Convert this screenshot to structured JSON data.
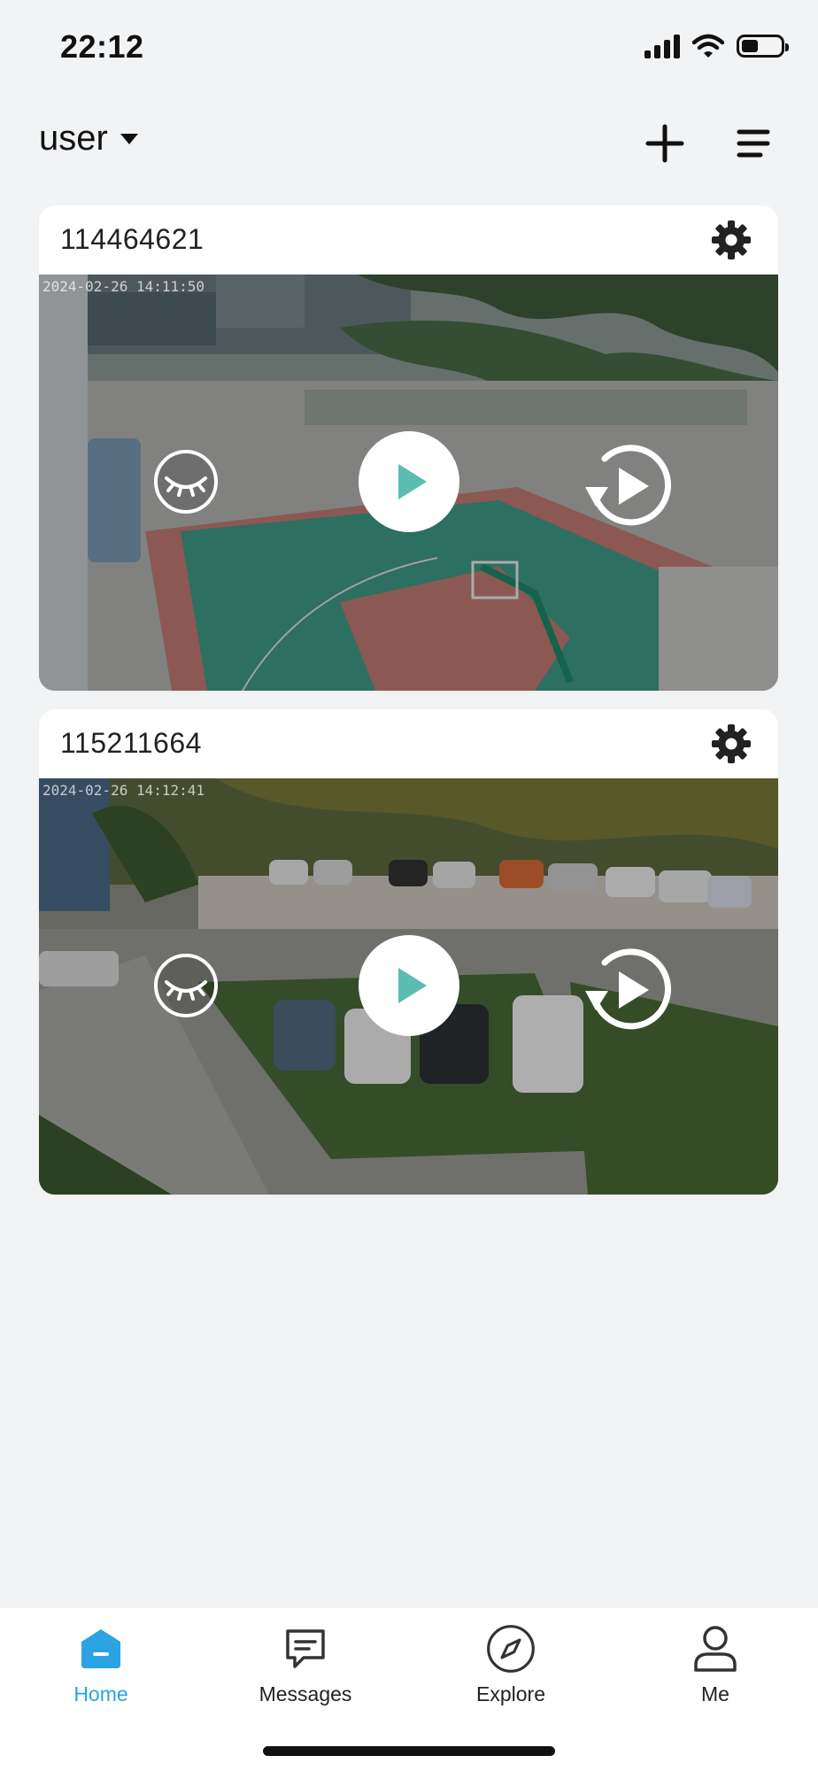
{
  "status_bar": {
    "time": "22:12"
  },
  "header": {
    "account": "user"
  },
  "devices": [
    {
      "id": "114464621",
      "timestamp": "2024-02-26 14:11:50"
    },
    {
      "id": "115211664",
      "timestamp": "2024-02-26 14:12:41"
    }
  ],
  "tabs": [
    {
      "label": "Home",
      "icon": "home-icon",
      "active": true
    },
    {
      "label": "Messages",
      "icon": "message-icon",
      "active": false
    },
    {
      "label": "Explore",
      "icon": "compass-icon",
      "active": false
    },
    {
      "label": "Me",
      "icon": "person-icon",
      "active": false
    }
  ],
  "colors": {
    "accent": "#2aa3e0",
    "play": "#5bbdb0",
    "background": "#f2f3f5"
  }
}
